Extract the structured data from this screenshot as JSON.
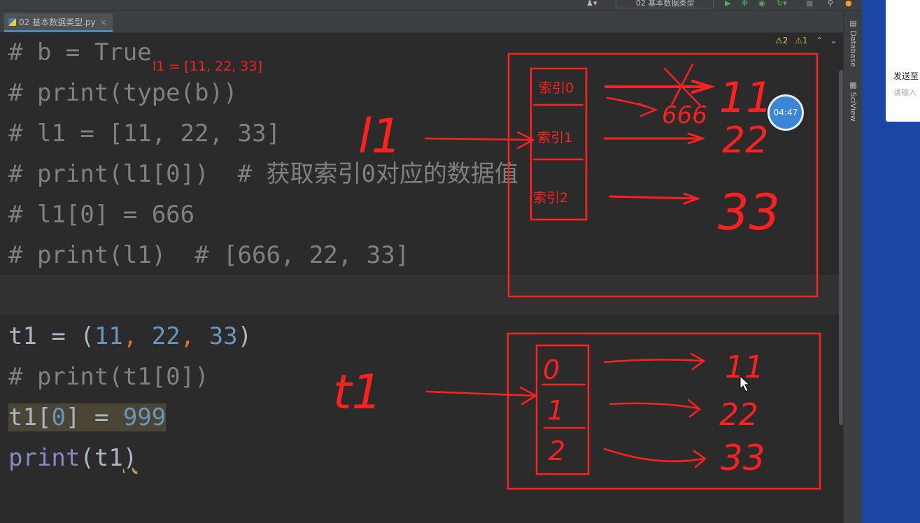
{
  "toolbar": {
    "run_config": "02 基本数据类型"
  },
  "tab": {
    "filename": "02 基本数据类型.py",
    "close": "×"
  },
  "inspections": {
    "warnings": "⚠2",
    "weak_warnings": "⚠1"
  },
  "right_tools": [
    "Database",
    "SciView"
  ],
  "code_lines": [
    "# b = True",
    "# print(type(b))",
    "# l1 = [11, 22, 33]",
    "# print(l1[0])  # 获取索引0对应的数据值",
    "# l1[0] = 666",
    "# print(l1)  # [666, 22, 33]",
    "",
    "t1 = (11, 22, 33)",
    "# print(t1[0])",
    "t1[0] = 999",
    "print(t1)"
  ],
  "code": {
    "t1_name": "t1",
    "assign": " = ",
    "paren_open": "(",
    "paren_close": ")",
    "n11": "11",
    "n22": "22",
    "n33": "33",
    "comma": ", ",
    "bracket_open": "[",
    "bracket_close": "]",
    "zero": "0",
    "n999": "999",
    "print_fn": "print"
  },
  "annotation": {
    "l1_label": "l1 = [11, 22, 33]",
    "index0": "索引0",
    "index1": "索引1",
    "index2": "索引2",
    "hand_l1": "l1",
    "hand_t1": "t1",
    "hand_11": "11",
    "hand_22": "22",
    "hand_33": "33",
    "hand_666": "666",
    "hand_0": "0",
    "hand_1": "1",
    "hand_2": "2"
  },
  "timer": "04:47",
  "popup": {
    "send_to": "发送至",
    "input_hint": "请输入"
  },
  "colors": {
    "annotation": "#ff2020",
    "editor_bg": "#2b2b2b",
    "comment": "#808080",
    "number": "#6897bb",
    "keyword": "#cc7832"
  }
}
